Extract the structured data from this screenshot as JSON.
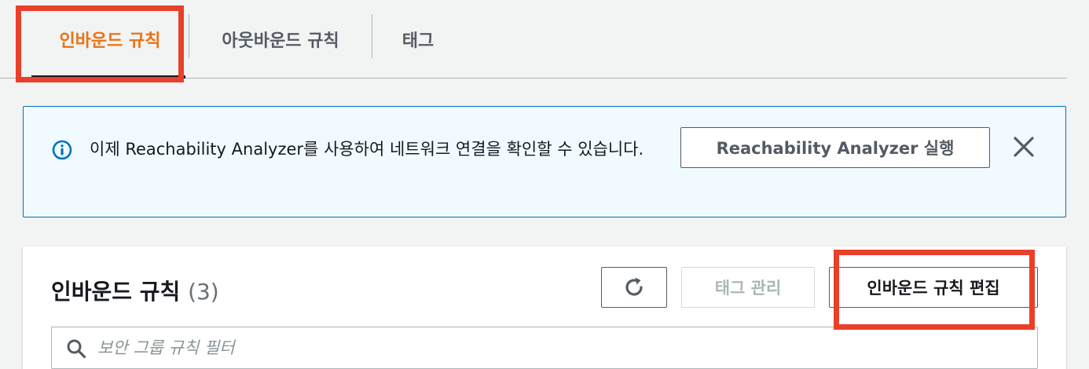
{
  "tabs": [
    {
      "label": "인바운드 규칙",
      "active": true
    },
    {
      "label": "아웃바운드 규칙",
      "active": false
    },
    {
      "label": "태그",
      "active": false
    }
  ],
  "alert": {
    "message": "이제 Reachability Analyzer를 사용하여 네트워크 연결을 확인할 수 있습니다.",
    "button_label": "Reachability Analyzer 실행",
    "icon": "info-icon",
    "close_icon": "close-icon"
  },
  "rules_panel": {
    "title": "인바운드 규칙",
    "count": "(3)",
    "refresh_icon": "refresh-icon",
    "manage_tags_label": "태그 관리",
    "edit_rules_label": "인바운드 규칙 편집",
    "search": {
      "placeholder": "보안 그룹 규칙 필터",
      "value": "",
      "icon": "search-icon"
    }
  },
  "colors": {
    "active_tab": "#ec7211",
    "highlight": "#e8402a",
    "info_blue": "#0073bb",
    "alert_bg": "#f1faff"
  }
}
